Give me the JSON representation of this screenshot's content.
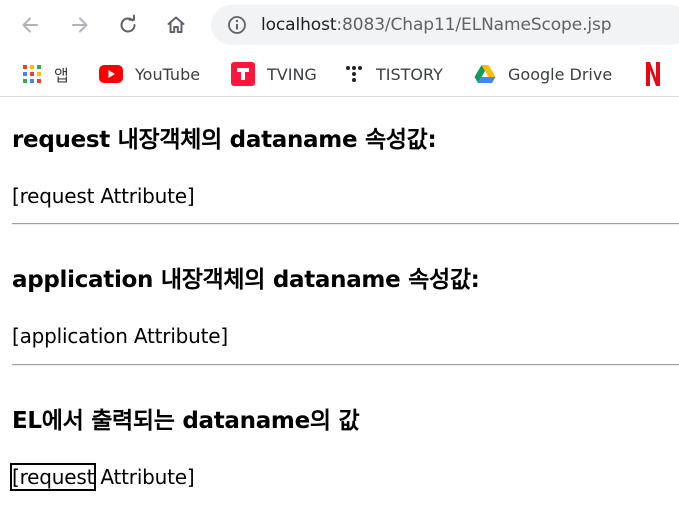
{
  "browser": {
    "url_host": "localhost",
    "url_path": ":8083/Chap11/ELNameScope.jsp"
  },
  "bookmarks": [
    {
      "label": "앱",
      "icon": "apps-grid-icon"
    },
    {
      "label": "YouTube",
      "icon": "youtube-icon"
    },
    {
      "label": "TVING",
      "icon": "tving-icon"
    },
    {
      "label": "TISTORY",
      "icon": "tistory-icon"
    },
    {
      "label": "Google Drive",
      "icon": "google-drive-icon"
    },
    {
      "label": "",
      "icon": "netflix-icon"
    }
  ],
  "page": {
    "sections": [
      {
        "heading": "request 내장객체의 dataname 속성값:",
        "value": "[request Attribute]"
      },
      {
        "heading": "application 내장객체의 dataname 속성값:",
        "value": "[application Attribute]"
      },
      {
        "heading": "EL에서 출력되는 dataname의 값",
        "value_part1": "[request",
        "value_part2": " Attribute]"
      }
    ]
  },
  "colors": {
    "youtube_red": "#ff0000",
    "tving_red": "#ff153c",
    "netflix_red": "#e50914"
  }
}
